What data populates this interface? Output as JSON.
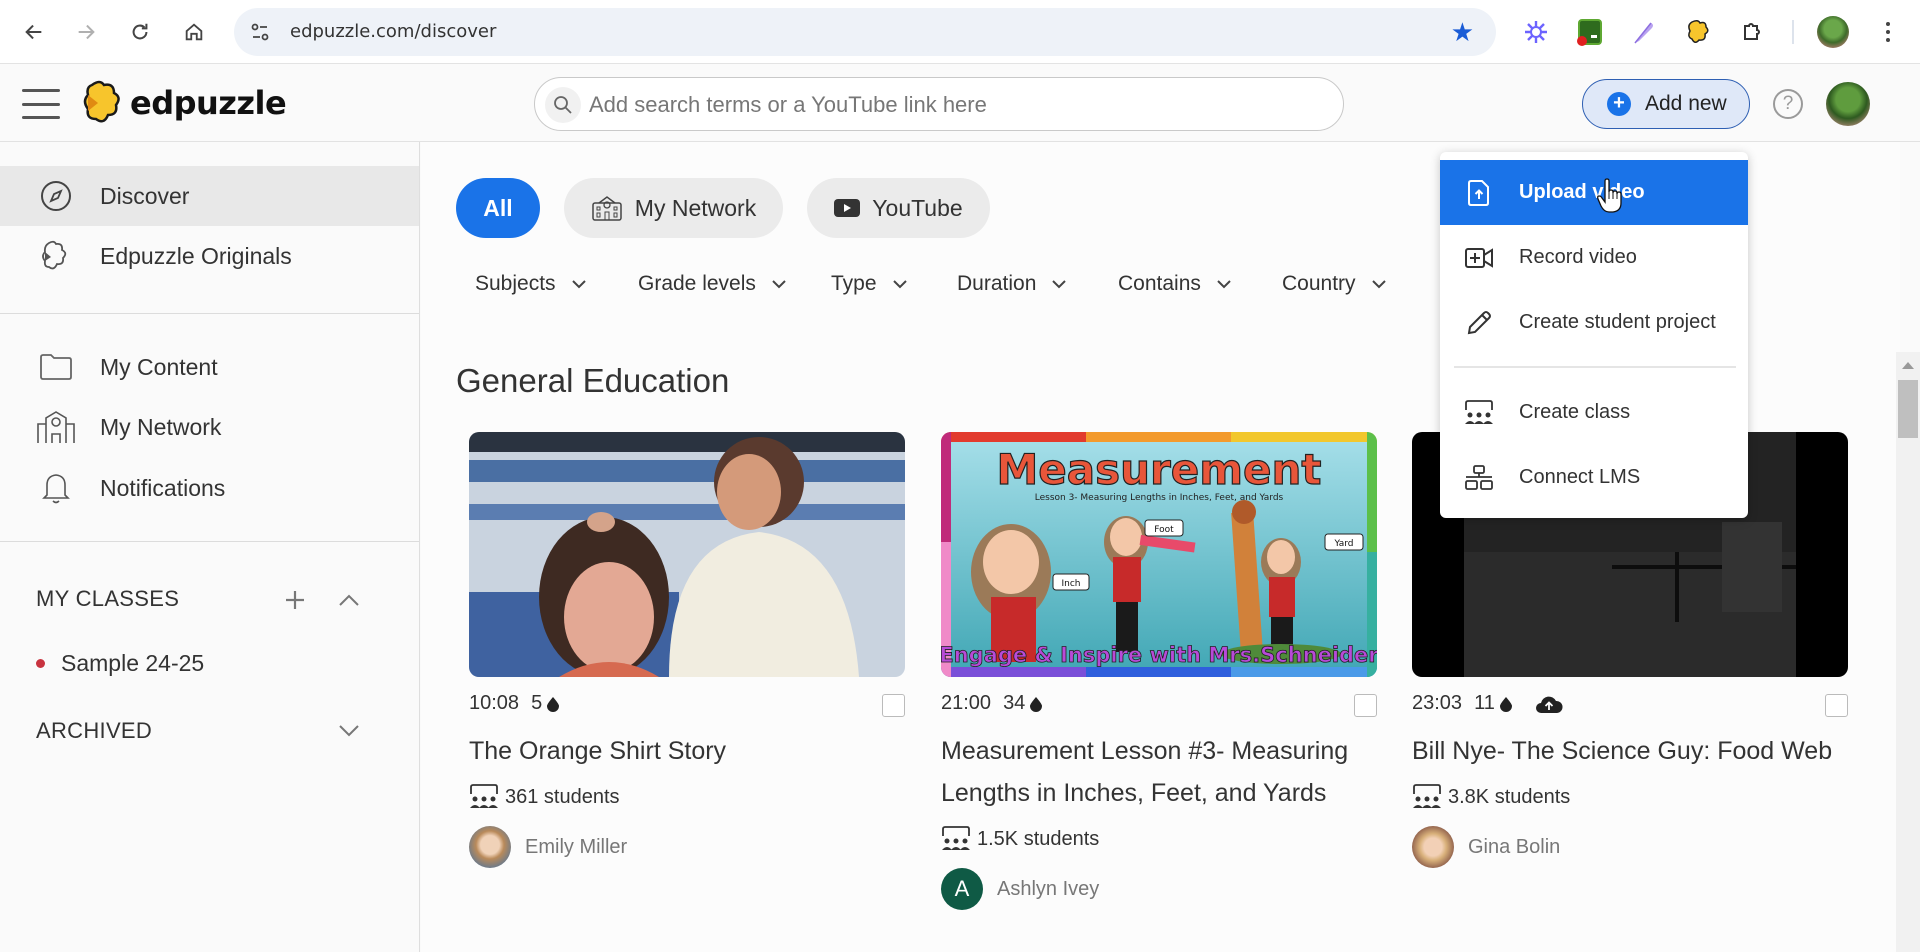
{
  "browser": {
    "url": "edpuzzle.com/discover",
    "back_label": "Back",
    "forward_label": "Forward",
    "reload_label": "Reload",
    "home_label": "Home",
    "bookmark_state": "bookmarked",
    "extensions": [
      "perplexity-icon",
      "classroom-screen-icon",
      "quill-icon",
      "edpuzzle-extension-icon",
      "extensions-puzzle-icon"
    ]
  },
  "header": {
    "logo_text": "edpuzzle",
    "search_placeholder": "Add search terms or a YouTube link here",
    "search_value": "",
    "add_new_label": "Add new",
    "help_label": "?"
  },
  "colors": {
    "accent": "#1a73e8",
    "class_dot": "#c8333f",
    "author_avatar_A": "#0f5a45"
  },
  "sidebar": {
    "items": [
      {
        "label": "Discover",
        "icon": "compass-icon",
        "active": true
      },
      {
        "label": "Edpuzzle Originals",
        "icon": "edpuzzle-puzzle-icon",
        "active": false
      },
      {
        "label": "My Content",
        "icon": "folder-icon",
        "active": false
      },
      {
        "label": "My Network",
        "icon": "school-building-icon",
        "active": false
      },
      {
        "label": "Notifications",
        "icon": "bell-icon",
        "active": false
      }
    ],
    "my_classes_title": "MY CLASSES",
    "classes": [
      {
        "label": "Sample 24-25"
      }
    ],
    "archived_title": "ARCHIVED"
  },
  "main": {
    "source_chips": [
      {
        "label": "All",
        "active": true
      },
      {
        "label": "My Network",
        "icon": "school-building-icon"
      },
      {
        "label": "YouTube",
        "icon": "youtube-icon"
      }
    ],
    "filters": [
      "Subjects",
      "Grade levels",
      "Type",
      "Duration",
      "Contains",
      "Country"
    ],
    "section_title": "General Education",
    "cards": [
      {
        "duration": "10:08",
        "questions": "5",
        "title": "The Orange Shirt Story",
        "students": "361 students",
        "author": "Emily Miller",
        "uploaded": false
      },
      {
        "duration": "21:00",
        "questions": "34",
        "title": "Measurement Lesson #3- Measuring Lengths in Inches, Feet, and Yards",
        "students": "1.5K students",
        "author": "Ashlyn Ivey",
        "author_initial": "A",
        "uploaded": false,
        "thumb_text": {
          "title": "Measurement",
          "subtitle": "Lesson 3- Measuring Lengths in Inches, Feet, and Yards",
          "labels": [
            "Inch",
            "Foot",
            "Yard"
          ],
          "footer": "Engage & Inspire with Mrs.Schneider"
        }
      },
      {
        "duration": "23:03",
        "questions": "11",
        "title": "Bill Nye- The Science Guy: Food Web",
        "students": "3.8K students",
        "author": "Gina Bolin",
        "uploaded": true
      }
    ]
  },
  "add_menu": {
    "items": [
      {
        "label": "Upload video",
        "icon": "upload-file-icon",
        "highlighted": true
      },
      {
        "label": "Record video",
        "icon": "record-video-icon"
      },
      {
        "label": "Create student project",
        "icon": "pencil-icon"
      },
      {
        "label": "Create class",
        "icon": "class-icon"
      },
      {
        "label": "Connect LMS",
        "icon": "lms-network-icon"
      }
    ]
  }
}
